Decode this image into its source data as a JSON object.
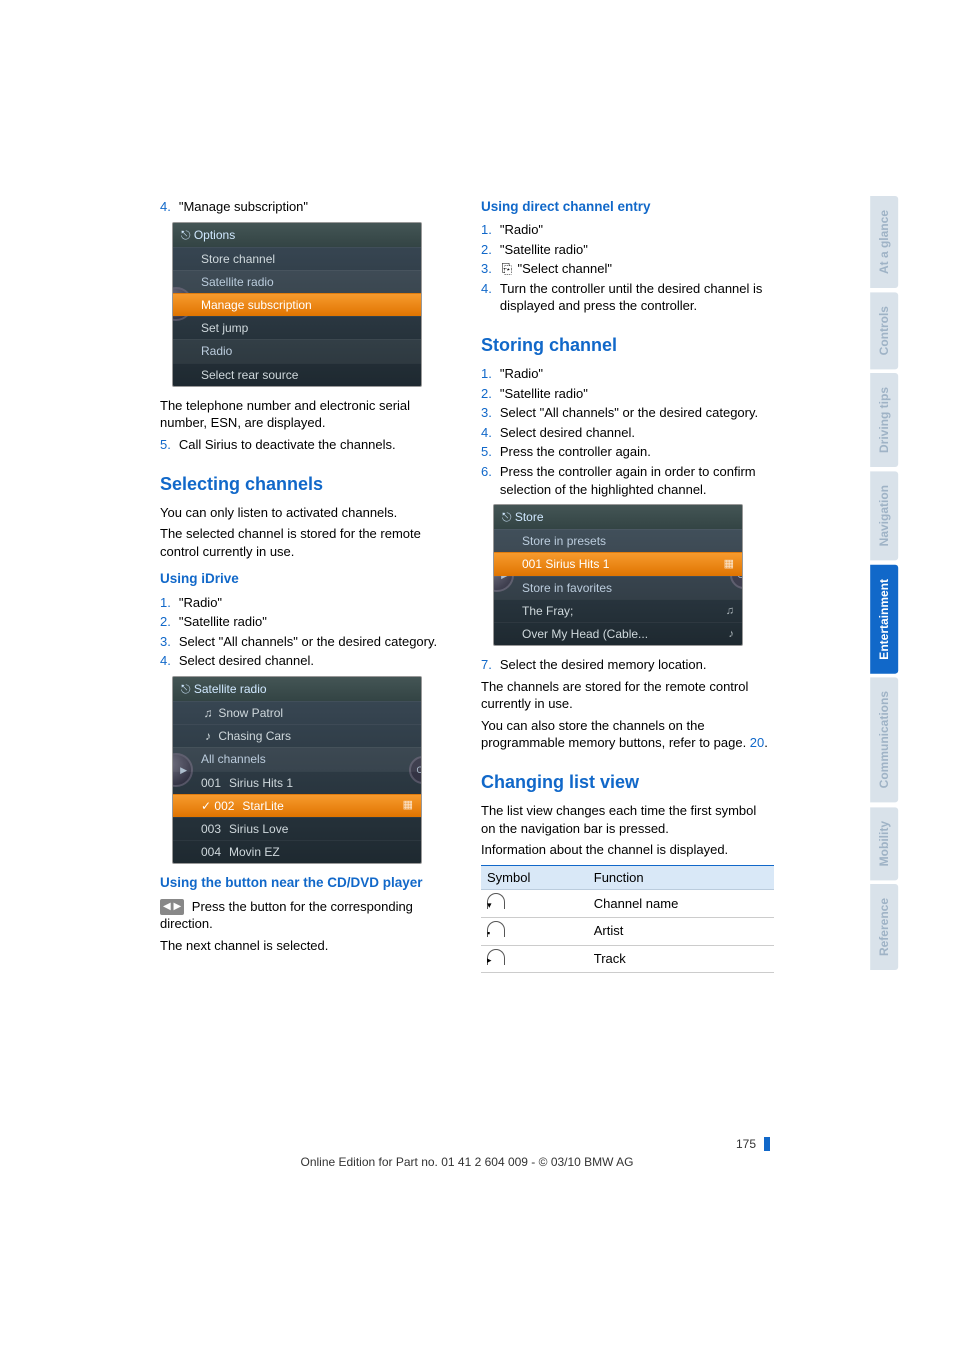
{
  "left": {
    "step4_num": "4.",
    "step4_text": "\"Manage subscription\"",
    "options_screen": {
      "title_icon": "⎋",
      "title": "Options",
      "rows": [
        {
          "label": "Store channel",
          "type": "plain"
        },
        {
          "label": "Satellite radio",
          "type": "section"
        },
        {
          "label": "Manage subscription",
          "type": "selected"
        },
        {
          "label": "Set jump",
          "type": "plain"
        },
        {
          "label": "Radio",
          "type": "section"
        },
        {
          "label": "Select rear source",
          "type": "plain"
        }
      ]
    },
    "para1a": "The telephone number and electronic serial number, ESN, are displayed.",
    "step5_num": "5.",
    "step5_text": "Call Sirius to deactivate the channels.",
    "h_selecting": "Selecting channels",
    "para2": "You can only listen to activated channels.",
    "para3": "The selected channel is stored for the remote control currently in use.",
    "h_idrive": "Using iDrive",
    "idrive_steps": [
      {
        "n": "1.",
        "t": "\"Radio\""
      },
      {
        "n": "2.",
        "t": "\"Satellite radio\""
      },
      {
        "n": "3.",
        "t": "Select \"All channels\" or the desired category."
      },
      {
        "n": "4.",
        "t": "Select desired channel."
      }
    ],
    "sat_screen": {
      "title_icon": "⎋",
      "title": "Satellite radio",
      "top_rows": [
        {
          "icon": "♫",
          "label": "Snow Patrol"
        },
        {
          "icon": "♪",
          "label": "Chasing Cars"
        }
      ],
      "section": "All channels",
      "rows": [
        {
          "num": "001",
          "label": "Sirius Hits 1",
          "selected": false,
          "tick": false
        },
        {
          "num": "002",
          "label": "StarLite",
          "selected": true,
          "tick": true,
          "right": "▦"
        },
        {
          "num": "003",
          "label": "Sirius Love",
          "selected": false,
          "tick": false
        },
        {
          "num": "004",
          "label": "Movin EZ",
          "selected": false,
          "tick": false
        }
      ]
    },
    "h_button": "Using the button near the CD/DVD player",
    "btn_chip": "◀  ▶",
    "btn_text": " Press the button for the corresponding direction.",
    "btn_para2": "The next channel is selected."
  },
  "right": {
    "h_direct": "Using direct channel entry",
    "direct_steps": [
      {
        "n": "1.",
        "t": "\"Radio\""
      },
      {
        "n": "2.",
        "t": "\"Satellite radio\""
      },
      {
        "n": "3.",
        "icon": "⎘",
        "t": " \"Select channel\""
      },
      {
        "n": "4.",
        "t": "Turn the controller until the desired channel is displayed and press the controller."
      }
    ],
    "h_storing": "Storing channel",
    "store_steps": [
      {
        "n": "1.",
        "t": "\"Radio\""
      },
      {
        "n": "2.",
        "t": "\"Satellite radio\""
      },
      {
        "n": "3.",
        "t": "Select \"All channels\" or the desired category."
      },
      {
        "n": "4.",
        "t": "Select desired channel."
      },
      {
        "n": "5.",
        "t": "Press the controller again."
      },
      {
        "n": "6.",
        "t": "Press the controller again in order to confirm selection of the highlighted channel."
      }
    ],
    "store_screen": {
      "title_icon": "⎋",
      "title": "Store",
      "rows": [
        {
          "label": "Store in presets",
          "type": "section"
        },
        {
          "label": "001   Sirius Hits 1",
          "type": "selected",
          "right": "▦"
        },
        {
          "label": "Store in favorites",
          "type": "section"
        },
        {
          "label": "The Fray;",
          "type": "plain",
          "right": "♫"
        },
        {
          "label": "Over My Head (Cable...",
          "type": "plain",
          "right": "♪"
        }
      ]
    },
    "step7_num": "7.",
    "step7_text": "Select the desired memory location.",
    "para_after1": "The channels are stored for the remote control currently in use.",
    "para_after2a": "You can also store the channels on the programmable memory buttons, refer to page.",
    "para_after2_link": " 20",
    "para_after2b": ".",
    "h_changing": "Changing list view",
    "changing_p1": "The list view changes each time the first symbol on the navigation bar is pressed.",
    "changing_p2": "Information about the channel is displayed.",
    "table_h1": "Symbol",
    "table_h2": "Function",
    "table_rows": [
      {
        "dot": "▾",
        "func": "Channel name"
      },
      {
        "dot": "▪",
        "func": "Artist"
      },
      {
        "dot": "▸",
        "func": "Track"
      }
    ]
  },
  "tabs": [
    "At a glance",
    "Controls",
    "Driving tips",
    "Navigation",
    "Entertainment",
    "Communications",
    "Mobility",
    "Reference"
  ],
  "active_tab_index": 4,
  "page_number": "175",
  "footer_line": "Online Edition for Part no. 01 41 2 604 009 - © 03/10 BMW AG"
}
